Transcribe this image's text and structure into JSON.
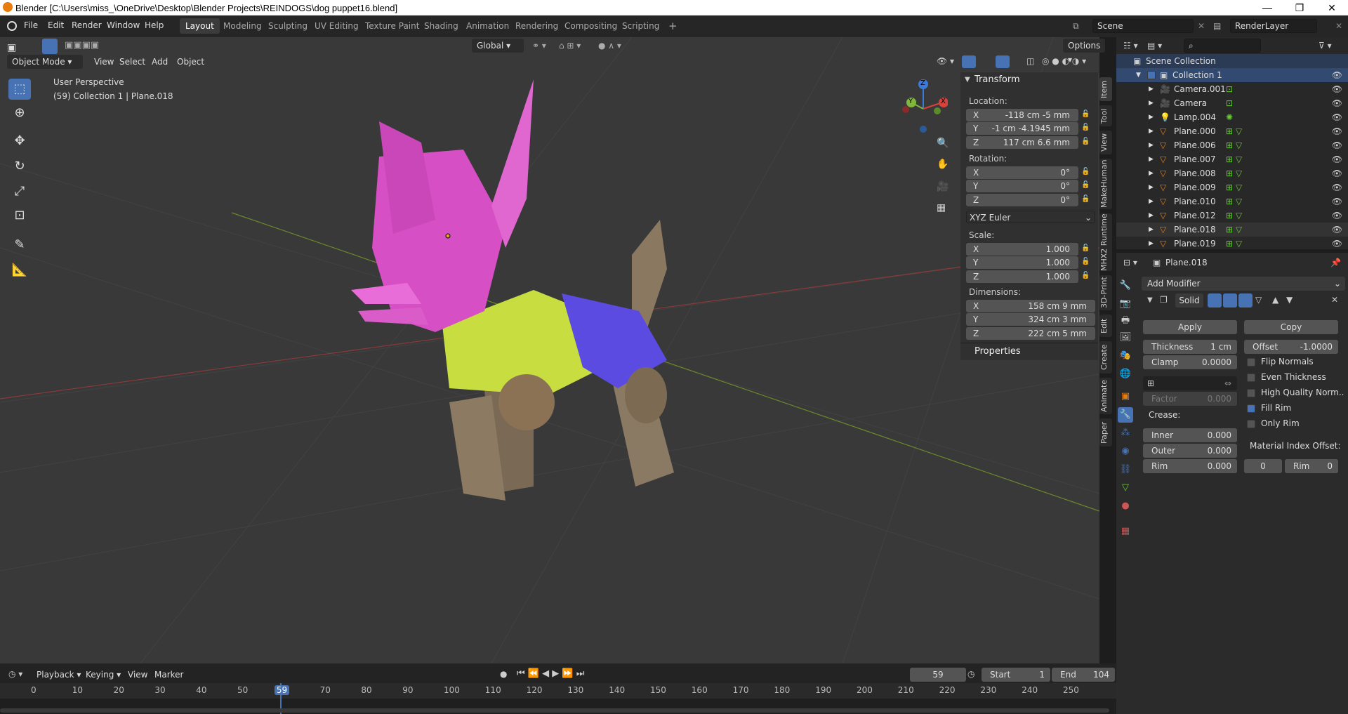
{
  "title": "Blender [C:\\Users\\miss_\\OneDrive\\Desktop\\Blender Projects\\REINDOGS\\dog puppet16.blend]",
  "window_controls": [
    "—",
    "❐",
    "✕"
  ],
  "menus": [
    "File",
    "Edit",
    "Render",
    "Window",
    "Help"
  ],
  "workspaces": [
    "Layout",
    "Modeling",
    "Sculpting",
    "UV Editing",
    "Texture Paint",
    "Shading",
    "Animation",
    "Rendering",
    "Compositing",
    "Scripting",
    "+"
  ],
  "scene_label": "Scene",
  "renderlayer_label": "RenderLayer",
  "viewport": {
    "mode": "Object Mode",
    "menus": [
      "View",
      "Select",
      "Add",
      "Object"
    ],
    "transform_orientation": "Global",
    "options_label": "Options",
    "info_line1": "User Perspective",
    "info_line2": "(59) Collection 1 | Plane.018",
    "gizmo_axes": {
      "x": "X",
      "y": "Y",
      "z": "Z"
    }
  },
  "npanel": {
    "transform_header": "Transform",
    "location_label": "Location:",
    "location": [
      {
        "ax": "X",
        "v": "-118 cm -5 mm"
      },
      {
        "ax": "Y",
        "v": "-1 cm -4.1945 mm"
      },
      {
        "ax": "Z",
        "v": "117 cm 6.6 mm"
      }
    ],
    "rotation_label": "Rotation:",
    "rotation": [
      {
        "ax": "X",
        "v": "0°"
      },
      {
        "ax": "Y",
        "v": "0°"
      },
      {
        "ax": "Z",
        "v": "0°"
      }
    ],
    "rotation_mode": "XYZ Euler",
    "scale_label": "Scale:",
    "scale": [
      {
        "ax": "X",
        "v": "1.000"
      },
      {
        "ax": "Y",
        "v": "1.000"
      },
      {
        "ax": "Z",
        "v": "1.000"
      }
    ],
    "dimensions_label": "Dimensions:",
    "dimensions": [
      {
        "ax": "X",
        "v": "158 cm 9 mm"
      },
      {
        "ax": "Y",
        "v": "324 cm 3 mm"
      },
      {
        "ax": "Z",
        "v": "222 cm 5 mm"
      }
    ],
    "properties_header": "Properties"
  },
  "sidetabs": [
    "Item",
    "Tool",
    "View",
    "MakeHuman",
    "MHX2 Runtime",
    "3D-Print",
    "Edit",
    "Create",
    "Animate",
    "Paper"
  ],
  "outliner": {
    "root": "Scene Collection",
    "collection": "Collection 1",
    "items": [
      "Camera.001",
      "Camera",
      "Lamp.004",
      "Plane.000",
      "Plane.006",
      "Plane.007",
      "Plane.008",
      "Plane.009",
      "Plane.010",
      "Plane.012",
      "Plane.018",
      "Plane.019"
    ]
  },
  "properties": {
    "object_name": "Plane.018",
    "add_modifier": "Add Modifier",
    "modifier_name": "Solid",
    "apply": "Apply",
    "copy": "Copy",
    "thickness_label": "Thickness",
    "thickness_value": "1 cm",
    "offset_label": "Offset",
    "offset_value": "-1.0000",
    "clamp_label": "Clamp",
    "clamp_value": "0.0000",
    "factor_label": "Factor",
    "factor_value": "0.000",
    "flip_normals": "Flip Normals",
    "even_thickness": "Even Thickness",
    "high_quality": "High Quality Norm..",
    "fill_rim": "Fill Rim",
    "only_rim": "Only Rim",
    "crease_label": "Crease:",
    "inner_label": "Inner",
    "inner_value": "0.000",
    "outer_label": "Outer",
    "outer_value": "0.000",
    "rim_label": "Rim",
    "rim_value": "0.000",
    "mat_index_label": "Material Index Offset:",
    "mat_index_value": "0",
    "mat_rim_label": "Rim",
    "mat_rim_value": "0"
  },
  "timeline": {
    "menus": [
      "Playback",
      "Keying",
      "View",
      "Marker"
    ],
    "current_frame": "59",
    "start_label": "Start",
    "start_value": "1",
    "end_label": "End",
    "end_value": "104",
    "ticks": [
      "0",
      "10",
      "20",
      "30",
      "40",
      "50",
      "59",
      "70",
      "80",
      "90",
      "100",
      "110",
      "120",
      "130",
      "140",
      "150",
      "160",
      "170",
      "180",
      "190",
      "200",
      "210",
      "220",
      "230",
      "240",
      "250"
    ]
  }
}
